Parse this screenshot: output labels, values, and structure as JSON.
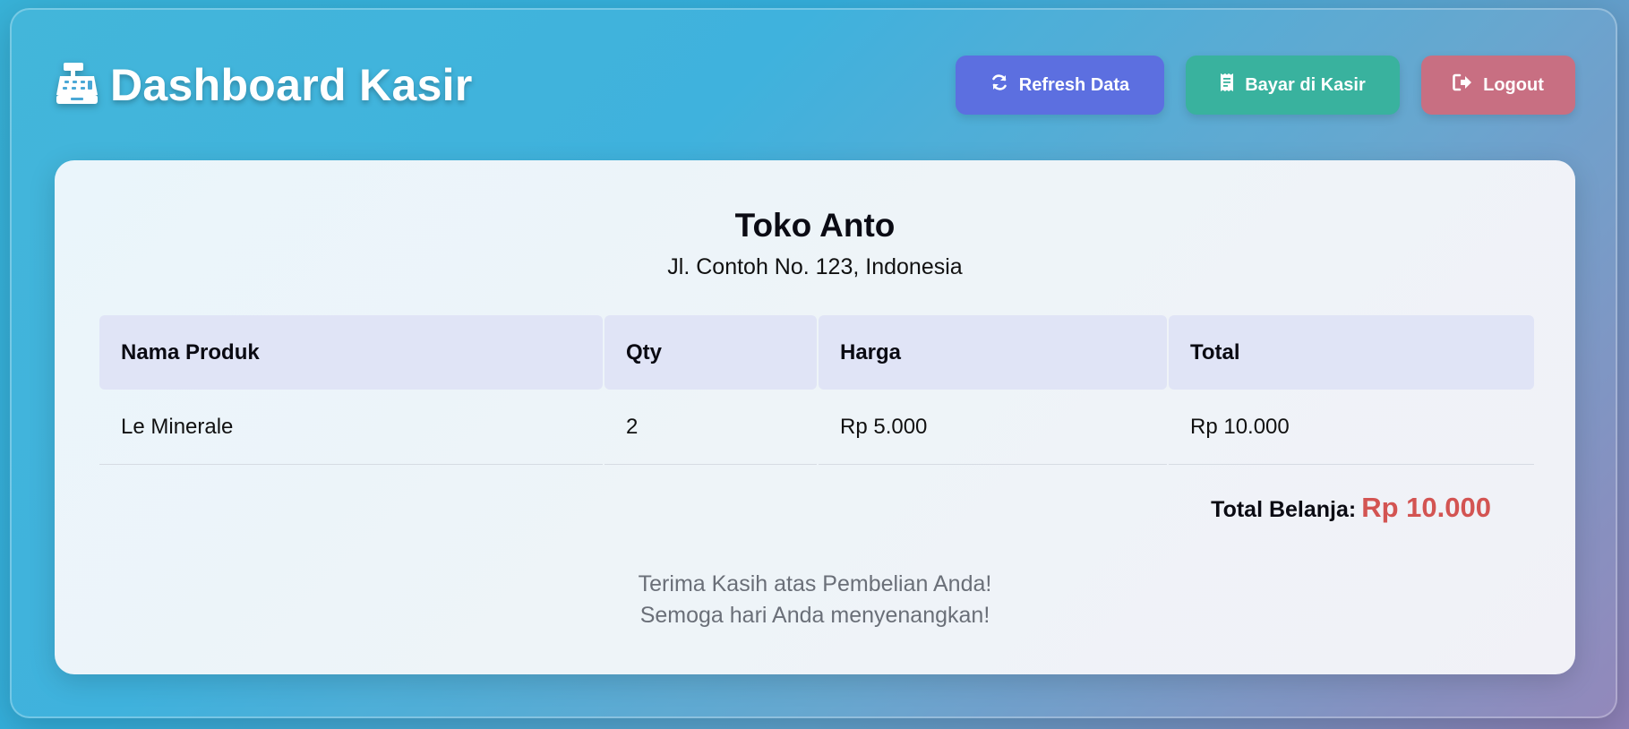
{
  "header": {
    "title": "Dashboard Kasir",
    "icon": "cash-register-icon"
  },
  "actions": {
    "refresh_label": "Refresh Data",
    "refresh_icon": "refresh-icon",
    "bayar_label": "Bayar di Kasir",
    "bayar_icon": "receipt-icon",
    "logout_label": "Logout",
    "logout_icon": "sign-out-icon",
    "colors": {
      "refresh": "#5c6fe0",
      "bayar": "#39b29e",
      "logout": "#c86f82"
    }
  },
  "receipt": {
    "store_name": "Toko Anto",
    "store_address": "Jl. Contoh No. 123, Indonesia",
    "columns": [
      "Nama Produk",
      "Qty",
      "Harga",
      "Total"
    ],
    "rows": [
      {
        "product": "Le Minerale",
        "qty": "2",
        "price": "Rp 5.000",
        "total": "Rp 10.000"
      }
    ],
    "grand_total_label": "Total Belanja:",
    "grand_total_value": "Rp 10.000",
    "thanks_line1": "Terima Kasih atas Pembelian Anda!",
    "thanks_line2": "Semoga hari Anda menyenangkan!",
    "accent_color": "#d35452"
  }
}
